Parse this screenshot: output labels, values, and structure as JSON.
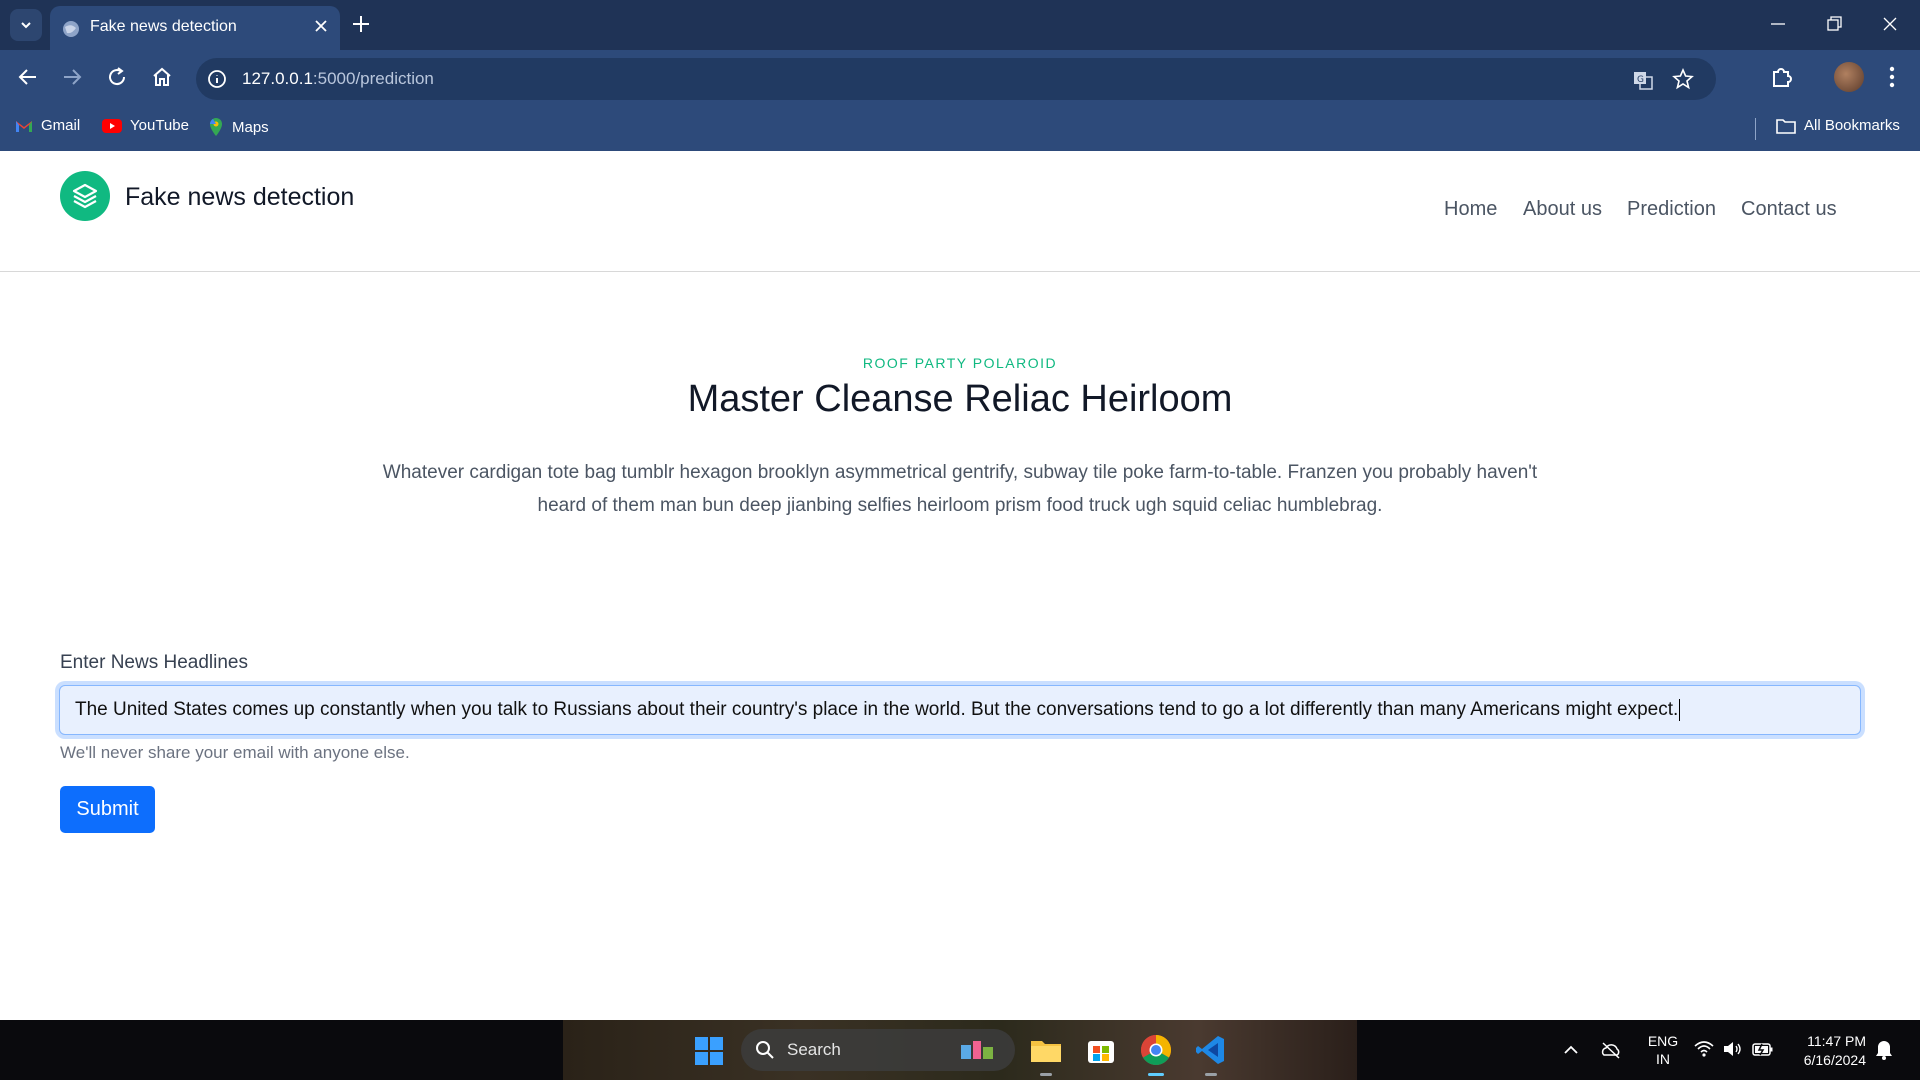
{
  "browser": {
    "tab_title": "Fake news detection",
    "url_host": "127.0.0.1",
    "url_path": ":5000/prediction",
    "bookmarks": [
      {
        "label": "Gmail",
        "icon": "gmail-icon"
      },
      {
        "label": "YouTube",
        "icon": "youtube-icon"
      },
      {
        "label": "Maps",
        "icon": "maps-icon"
      }
    ],
    "all_bookmarks": "All Bookmarks"
  },
  "site": {
    "brand": "Fake news detection",
    "nav": [
      "Home",
      "About us",
      "Prediction",
      "Contact us"
    ]
  },
  "hero": {
    "kicker": "ROOF PARTY POLAROID",
    "title": "Master Cleanse Reliac Heirloom",
    "lead": "Whatever cardigan tote bag tumblr hexagon brooklyn asymmetrical gentrify, subway tile poke farm-to-table. Franzen you probably haven't heard of them man bun deep jianbing selfies heirloom prism food truck ugh squid celiac humblebrag."
  },
  "form": {
    "label": "Enter News Headlines",
    "value": "The United States comes up constantly when you talk to Russians about their country's place in the world. But the conversations tend to go a lot differently than many Americans might expect.",
    "help": "We'll never share your email with anyone else.",
    "submit": "Submit"
  },
  "taskbar": {
    "search": "Search",
    "lang_line1": "ENG",
    "lang_line2": "IN",
    "time": "11:47 PM",
    "date": "6/16/2024"
  },
  "colors": {
    "chrome_dark": "#1f3356",
    "chrome": "#2d4a7a",
    "accent_green": "#10b981",
    "button_blue": "#0d6efd"
  }
}
